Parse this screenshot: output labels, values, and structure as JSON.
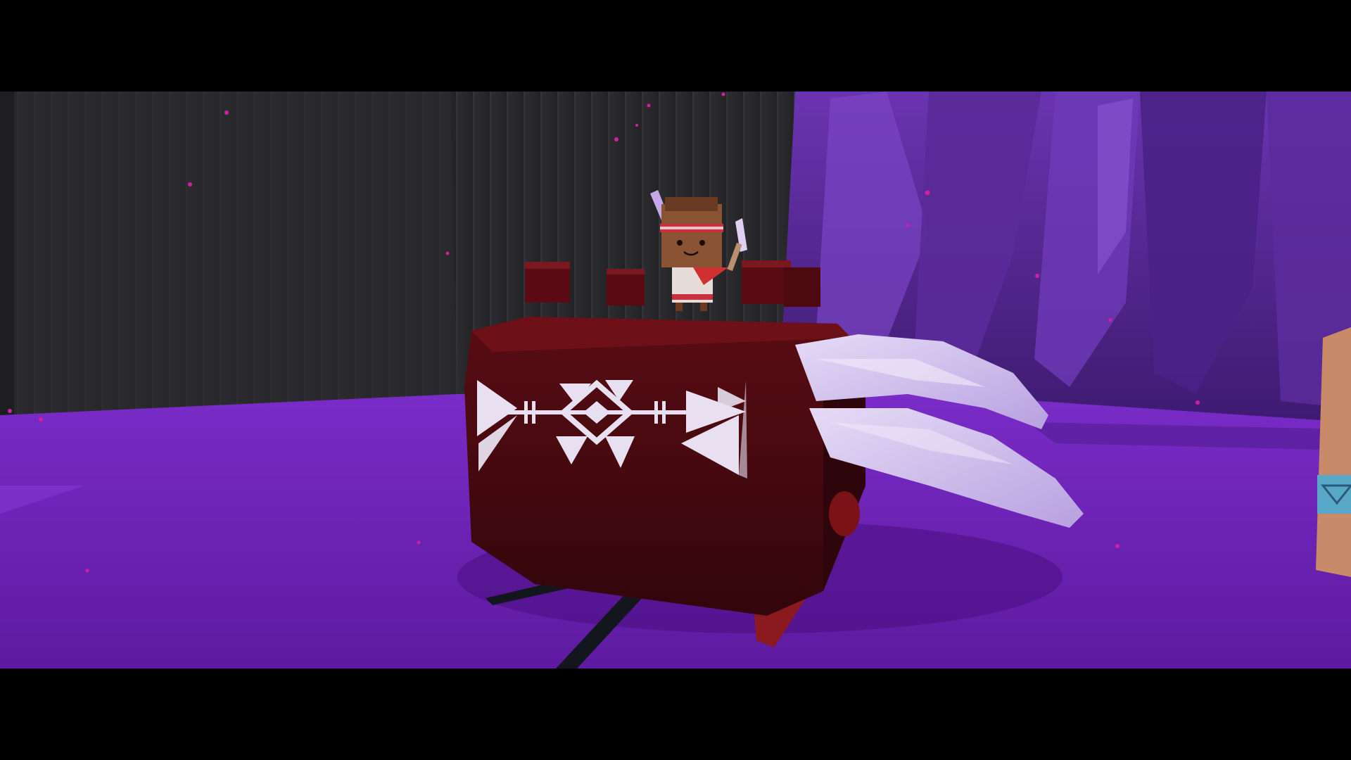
{
  "scene": {
    "name": "purple-cave-boss-arena",
    "colors": {
      "wall_dark": "#2b2a2d",
      "wall_mid": "#3a383c",
      "floor_purple": "#6a1fb0",
      "floor_light": "#8a35d4",
      "crystal_purple": "#5a2a9a",
      "beetle_body": "#4a0a10",
      "beetle_dark": "#2a0508",
      "horn_white": "#d8c8f0",
      "pattern_white": "#e8e0f0",
      "particle_magenta": "#d020a0",
      "letterbox": "#000000"
    }
  },
  "boss": {
    "name": "giant-tribal-beetle",
    "pattern": "tribal-arrow-motif"
  },
  "player": {
    "name": "feathered-headband-character"
  }
}
